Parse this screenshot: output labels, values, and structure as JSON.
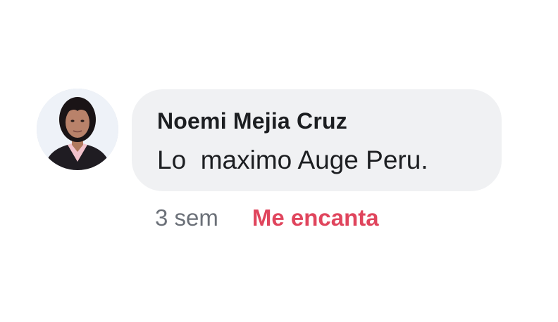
{
  "comment": {
    "author": "Noemi Mejia Cruz",
    "text": "Lo  maximo Auge Peru.",
    "time": "3 sem",
    "reaction_label": "Me encanta",
    "reaction_color": "#e0455d"
  }
}
